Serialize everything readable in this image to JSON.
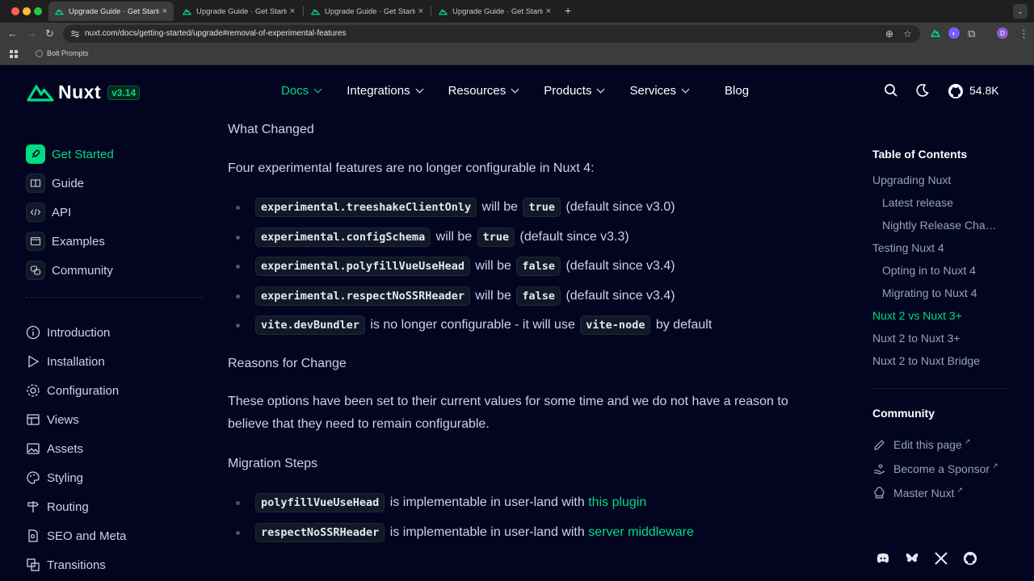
{
  "browser": {
    "tabs": [
      {
        "title": "Upgrade Guide · Get Started",
        "active": true
      },
      {
        "title": "Upgrade Guide · Get Started",
        "active": false
      },
      {
        "title": "Upgrade Guide · Get Started",
        "active": false
      },
      {
        "title": "Upgrade Guide · Get Started",
        "active": false
      }
    ],
    "new_tab": "+",
    "url": "nuxt.com/docs/getting-started/upgrade#removal-of-experimental-features",
    "profile_initial": "D",
    "bookmark": "Bolt Prompts"
  },
  "header": {
    "logo_text": "Nuxt",
    "version": "v3.14",
    "nav": [
      "Docs",
      "Integrations",
      "Resources",
      "Products",
      "Services",
      "Blog"
    ],
    "stars": "54.8K"
  },
  "sidebar": {
    "top": [
      "Get Started",
      "Guide",
      "API",
      "Examples",
      "Community"
    ],
    "items": [
      "Introduction",
      "Installation",
      "Configuration",
      "Views",
      "Assets",
      "Styling",
      "Routing",
      "SEO and Meta",
      "Transitions"
    ]
  },
  "content": {
    "what_changed": "What Changed",
    "intro": "Four experimental features are no longer configurable in Nuxt 4:",
    "b1_code": "experimental.treeshakeClientOnly",
    "b1_mid": "will be",
    "b1_val": "true",
    "b1_tail": "(default since v3.0)",
    "b2_code": "experimental.configSchema",
    "b2_mid": "will be",
    "b2_val": "true",
    "b2_tail": "(default since v3.3)",
    "b3_code": "experimental.polyfillVueUseHead",
    "b3_mid": "will be",
    "b3_val": "false",
    "b3_tail": "(default since v3.4)",
    "b4_code": "experimental.respectNoSSRHeader",
    "b4_mid": "will be",
    "b4_val": "false",
    "b4_tail": "(default since v3.4)",
    "b5_code": "vite.devBundler",
    "b5_mid": "is no longer configurable - it will use",
    "b5_val": "vite-node",
    "b5_tail": "by default",
    "reasons": "Reasons for Change",
    "reasons_text": "These options have been set to their current values for some time and we do not have a reason to believe that they need to remain configurable.",
    "migration": "Migration Steps",
    "m1_code": "polyfillVueUseHead",
    "m1_text": "is implementable in user-land with",
    "m1_link": "this plugin",
    "m2_code": "respectNoSSRHeader",
    "m2_text": "is implementable in user-land with",
    "m2_link": "server middleware"
  },
  "toc": {
    "title": "Table of Contents",
    "items": [
      {
        "label": "Upgrading Nuxt",
        "level": 1
      },
      {
        "label": "Latest release",
        "level": 2
      },
      {
        "label": "Nightly Release Cha…",
        "level": 2
      },
      {
        "label": "Testing Nuxt 4",
        "level": 1
      },
      {
        "label": "Opting in to Nuxt 4",
        "level": 2
      },
      {
        "label": "Migrating to Nuxt 4",
        "level": 2
      },
      {
        "label": "Nuxt 2 vs Nuxt 3+",
        "level": 1,
        "active": true
      },
      {
        "label": "Nuxt 2 to Nuxt 3+",
        "level": 1
      },
      {
        "label": "Nuxt 2 to Nuxt Bridge",
        "level": 1
      }
    ],
    "community_title": "Community",
    "community": [
      "Edit this page",
      "Become a Sponsor",
      "Master Nuxt"
    ]
  },
  "colors": {
    "accent": "#00dc82",
    "background": "#020420"
  }
}
